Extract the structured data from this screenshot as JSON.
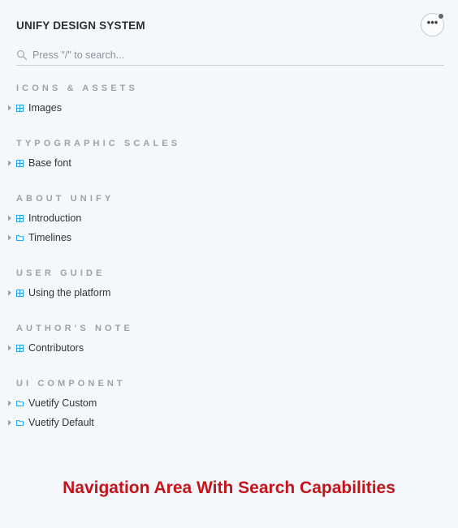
{
  "header": {
    "title": "UNIFY DESIGN SYSTEM",
    "menu_icon": "more-horizontal-icon",
    "notification_color": "#5d6b62"
  },
  "search": {
    "placeholder": "Press \"/\" to search...",
    "value": ""
  },
  "sections": [
    {
      "title": "ICONS & ASSETS",
      "items": [
        {
          "label": "Images",
          "icon": "grid-icon"
        }
      ]
    },
    {
      "title": "TYPOGRAPHIC SCALES",
      "items": [
        {
          "label": "Base font",
          "icon": "grid-icon"
        }
      ]
    },
    {
      "title": "ABOUT UNIFY",
      "items": [
        {
          "label": "Introduction",
          "icon": "grid-icon"
        },
        {
          "label": "Timelines",
          "icon": "folder-icon"
        }
      ]
    },
    {
      "title": "USER GUIDE",
      "items": [
        {
          "label": "Using the platform",
          "icon": "grid-icon"
        }
      ]
    },
    {
      "title": "AUTHOR'S NOTE",
      "items": [
        {
          "label": "Contributors",
          "icon": "grid-icon"
        }
      ]
    },
    {
      "title": "UI COMPONENT",
      "items": [
        {
          "label": "Vuetify Custom",
          "icon": "folder-icon"
        },
        {
          "label": "Vuetify Default",
          "icon": "folder-icon"
        }
      ]
    }
  ],
  "caption": "Navigation Area With Search Capabilities",
  "colors": {
    "accent": "#1ea7fd",
    "caption": "#c4141b",
    "section_title": "#9aa2ab"
  }
}
